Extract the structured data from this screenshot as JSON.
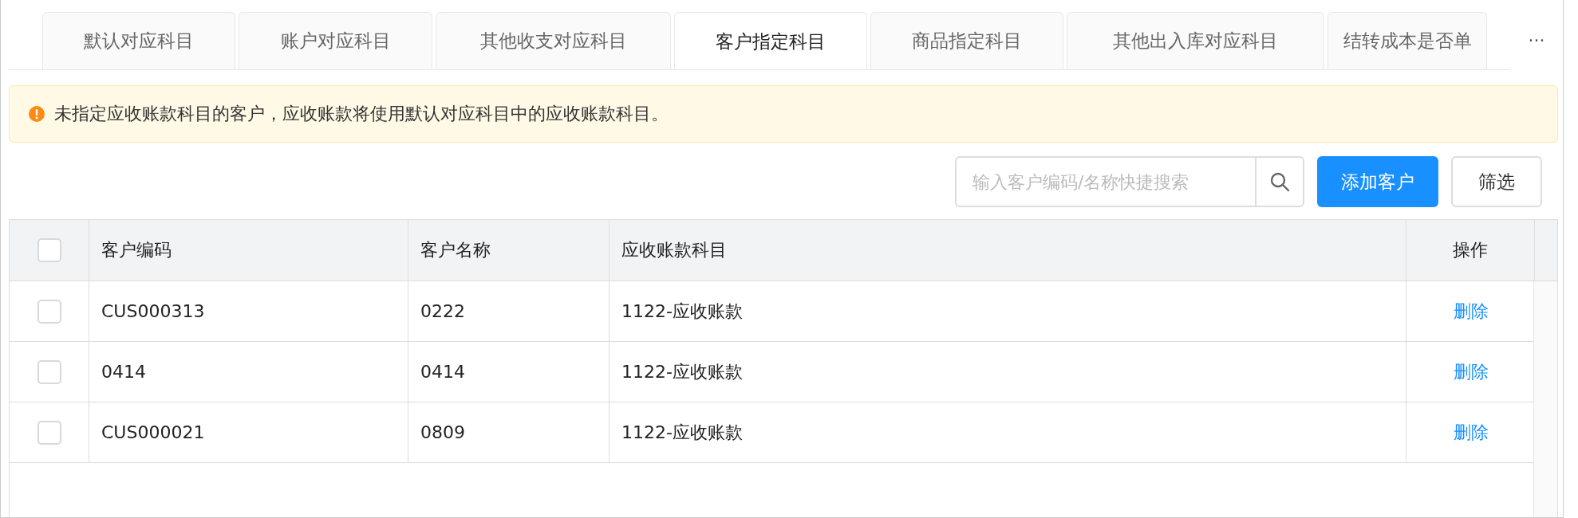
{
  "tabs": [
    {
      "label": "默认对应科目",
      "selected": false
    },
    {
      "label": "账户对应科目",
      "selected": false
    },
    {
      "label": "其他收支对应科目",
      "selected": false
    },
    {
      "label": "客户指定科目",
      "selected": true
    },
    {
      "label": "商品指定科目",
      "selected": false
    },
    {
      "label": "其他出入库对应科目",
      "selected": false
    },
    {
      "label": "结转成本是否单",
      "selected": false
    }
  ],
  "more_tabs": "...",
  "alert": {
    "text": "未指定应收账款科目的客户，应收账款将使用默认对应科目中的应收账款科目。"
  },
  "search": {
    "placeholder": "输入客户编码/名称快捷搜索"
  },
  "buttons": [
    {
      "label": "添加客户",
      "kind": "primary"
    },
    {
      "label": "筛选",
      "kind": "default"
    }
  ],
  "table": {
    "select_all": {
      "checked": false
    },
    "columns": [
      "客户编码",
      "客户名称",
      "应收账款科目",
      "操作"
    ],
    "rows": [
      {
        "checked": false,
        "cells": [
          "CUS000313",
          "0222",
          "1122-应收账款"
        ],
        "action": "删除"
      },
      {
        "checked": false,
        "cells": [
          "0414",
          "0414",
          "1122-应收账款"
        ],
        "action": "删除"
      },
      {
        "checked": false,
        "cells": [
          "CUS000021",
          "0809",
          "1122-应收账款"
        ],
        "action": "删除"
      }
    ]
  }
}
